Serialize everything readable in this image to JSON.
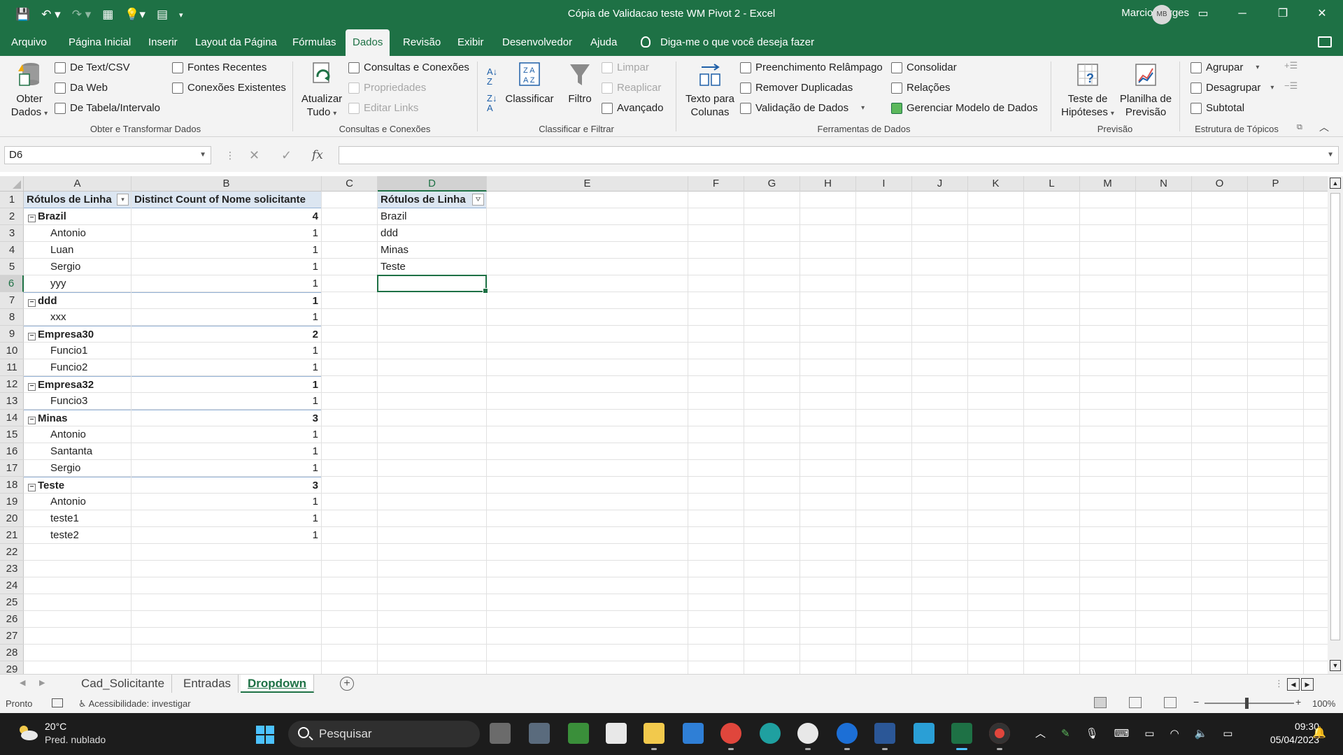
{
  "window": {
    "title": "Cópia de Validacao teste WM Pivot 2  -  Excel",
    "user_name": "Marcio Borges",
    "user_initials": "MB"
  },
  "menu": {
    "tabs": [
      "Arquivo",
      "Página Inicial",
      "Inserir",
      "Layout da Página",
      "Fórmulas",
      "Dados",
      "Revisão",
      "Exibir",
      "Desenvolvedor",
      "Ajuda"
    ],
    "active_tab": "Dados",
    "tell_me": "Diga-me o que você deseja fazer"
  },
  "ribbon": {
    "get_data": {
      "obter_line1": "Obter",
      "obter_line2": "Dados",
      "from_text": "De Text/CSV",
      "from_web": "Da Web",
      "from_table": "De Tabela/Intervalo",
      "recent_sources": "Fontes Recentes",
      "existing_connections": "Conexões Existentes",
      "label": "Obter e Transformar Dados"
    },
    "queries": {
      "refresh_line1": "Atualizar",
      "refresh_line2": "Tudo",
      "queries_connections": "Consultas e Conexões",
      "properties": "Propriedades",
      "edit_links": "Editar Links",
      "label": "Consultas e Conexões"
    },
    "sort_filter": {
      "sort": "Classificar",
      "filter": "Filtro",
      "clear": "Limpar",
      "reapply": "Reaplicar",
      "advanced": "Avançado",
      "label": "Classificar e Filtrar"
    },
    "data_tools": {
      "text_to_columns_line1": "Texto para",
      "text_to_columns_line2": "Colunas",
      "flash_fill": "Preenchimento Relâmpago",
      "remove_duplicates": "Remover Duplicadas",
      "data_validation": "Validação de Dados",
      "consolidate": "Consolidar",
      "relationships": "Relações",
      "manage_data_model": "Gerenciar Modelo de Dados",
      "label": "Ferramentas de Dados"
    },
    "forecast": {
      "what_if_line1": "Teste de",
      "what_if_line2": "Hipóteses",
      "forecast_sheet_line1": "Planilha de",
      "forecast_sheet_line2": "Previsão",
      "label": "Previsão"
    },
    "outline": {
      "group": "Agrupar",
      "ungroup": "Desagrupar",
      "subtotal": "Subtotal",
      "label": "Estrutura de Tópicos"
    }
  },
  "formula_bar": {
    "name_box": "D6",
    "fx": "fx",
    "formula": ""
  },
  "grid": {
    "columns": [
      "A",
      "B",
      "C",
      "D",
      "E",
      "F",
      "G",
      "H",
      "I",
      "J",
      "K",
      "L",
      "M",
      "N",
      "O",
      "P"
    ],
    "selected_column": "D",
    "rows": [
      "1",
      "2",
      "3",
      "4",
      "5",
      "6",
      "7",
      "8",
      "9",
      "10",
      "11",
      "12",
      "13",
      "14",
      "15",
      "16",
      "17",
      "18",
      "19",
      "20",
      "21",
      "22",
      "23",
      "24",
      "25",
      "26",
      "27",
      "28",
      "29"
    ],
    "selected_row": "6"
  },
  "pivot1": {
    "header_labels": "Rótulos de Linha",
    "header_value": "Distinct Count of Nome solicitante",
    "rows": [
      {
        "label": "Brazil",
        "value": "4",
        "group": true
      },
      {
        "label": "Antonio",
        "value": "1",
        "group": false
      },
      {
        "label": "Luan",
        "value": "1",
        "group": false
      },
      {
        "label": "Sergio",
        "value": "1",
        "group": false
      },
      {
        "label": "yyy",
        "value": "1",
        "group": false
      },
      {
        "label": "ddd",
        "value": "1",
        "group": true
      },
      {
        "label": "xxx",
        "value": "1",
        "group": false
      },
      {
        "label": "Empresa30",
        "value": "2",
        "group": true
      },
      {
        "label": "Funcio1",
        "value": "1",
        "group": false
      },
      {
        "label": "Funcio2",
        "value": "1",
        "group": false
      },
      {
        "label": "Empresa32",
        "value": "1",
        "group": true
      },
      {
        "label": "Funcio3",
        "value": "1",
        "group": false
      },
      {
        "label": "Minas",
        "value": "3",
        "group": true
      },
      {
        "label": "Antonio",
        "value": "1",
        "group": false
      },
      {
        "label": "Santanta",
        "value": "1",
        "group": false
      },
      {
        "label": "Sergio",
        "value": "1",
        "group": false
      },
      {
        "label": "Teste",
        "value": "3",
        "group": true
      },
      {
        "label": "Antonio",
        "value": "1",
        "group": false
      },
      {
        "label": "teste1",
        "value": "1",
        "group": false
      },
      {
        "label": "teste2",
        "value": "1",
        "group": false
      }
    ]
  },
  "pivot2": {
    "header": "Rótulos de Linha",
    "rows": [
      "Brazil",
      "ddd",
      "Minas",
      "Teste"
    ]
  },
  "sheets": {
    "tabs": [
      "Cad_Solicitante",
      "Entradas",
      "Dropdown"
    ],
    "active": "Dropdown"
  },
  "status": {
    "ready": "Pronto",
    "accessibility": "Acessibilidade: investigar",
    "zoom": "100%"
  },
  "taskbar": {
    "temperature": "20°C",
    "weather": "Pred. nublado",
    "search": "Pesquisar",
    "time": "09:30",
    "date": "05/04/2023"
  },
  "colors": {
    "excel_green": "#1e7145",
    "pivot_header": "#dce6f1",
    "taskbar": "#1c1c1c"
  }
}
